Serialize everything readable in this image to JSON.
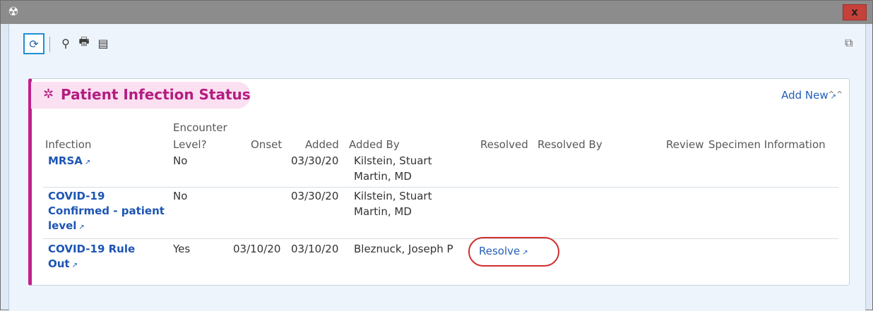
{
  "window": {
    "app_icon": "☢",
    "close_label": "x"
  },
  "toolbar": {
    "refresh_icon": "⟳",
    "search_icon": "⚲",
    "print_icon": "🖶",
    "copy_icon": "▤",
    "right_icon": "⧉"
  },
  "panel": {
    "title": "Patient Infection Status",
    "add_new": "Add New",
    "collapse_icon": "⌃⌃"
  },
  "table": {
    "headers": {
      "infection": "Infection",
      "encounter_1": "Encounter",
      "encounter_2": "Level?",
      "onset": "Onset",
      "added": "Added",
      "added_by": "Added By",
      "resolved": "Resolved",
      "resolved_by": "Resolved By",
      "review": "Review",
      "specimen": "Specimen Information"
    },
    "rows": [
      {
        "infection_1": "MRSA",
        "infection_2": "",
        "infection_3": "",
        "encounter": "No",
        "onset": "",
        "added": "03/30/20",
        "added_by_1": "Kilstein, Stuart",
        "added_by_2": "Martin, MD",
        "resolved": ""
      },
      {
        "infection_1": "COVID-19",
        "infection_2": "Confirmed - patient",
        "infection_3": "level",
        "encounter": "No",
        "onset": "",
        "added": "03/30/20",
        "added_by_1": "Kilstein, Stuart",
        "added_by_2": "Martin, MD",
        "resolved": ""
      },
      {
        "infection_1": "COVID-19 Rule",
        "infection_2": "Out",
        "infection_3": "",
        "encounter": "Yes",
        "onset": "03/10/20",
        "added": "03/10/20",
        "added_by_1": "Bleznuck, Joseph P",
        "added_by_2": "",
        "resolved": "Resolve"
      }
    ]
  },
  "ext_icon": "↗",
  "colors": {
    "accent": "#c0208a",
    "link": "#1e55b4",
    "highlight": "#d12f2f"
  }
}
